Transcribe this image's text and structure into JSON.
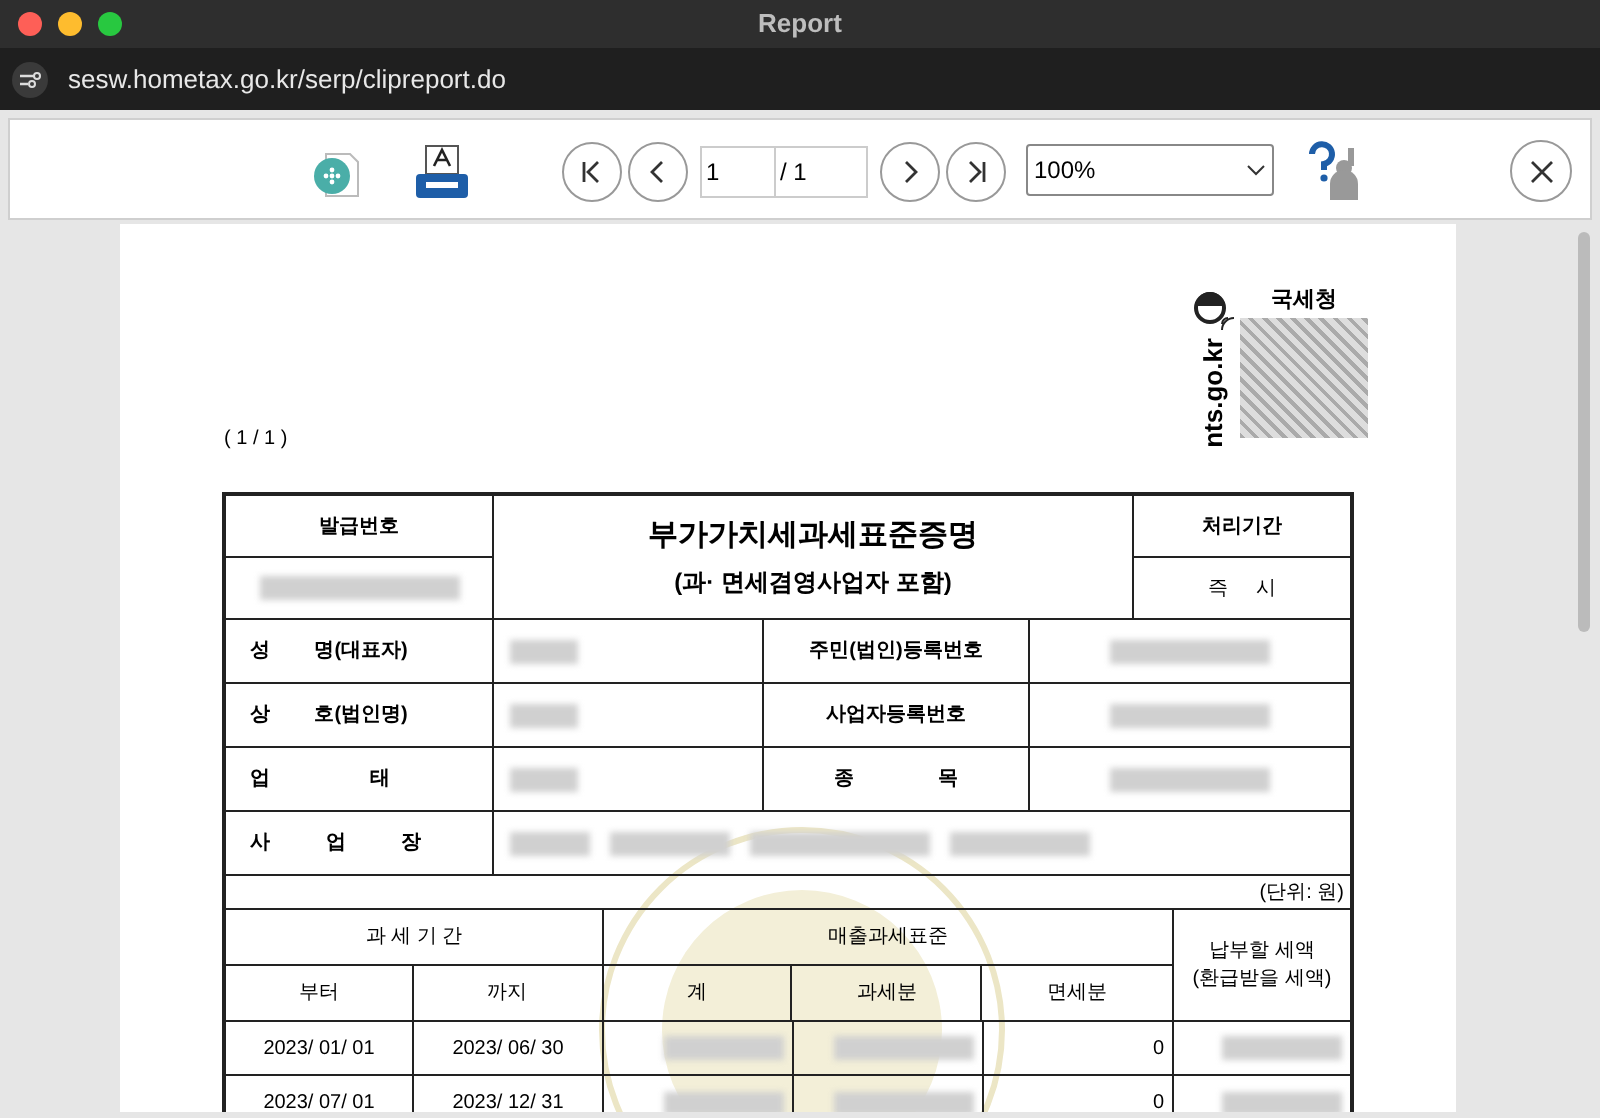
{
  "window": {
    "title": "Report"
  },
  "address_bar": {
    "url": "sesw.hometax.go.kr/serp/clipreport.do"
  },
  "toolbar": {
    "page_input": "1",
    "page_total": "/ 1",
    "zoom": "100%"
  },
  "document": {
    "page_indicator": "( 1 / 1 )",
    "agency": "국세청",
    "site": "nts.go.kr",
    "issue_label": "발급번호",
    "title": "부가가치세과세표준증명",
    "subtitle": "(과· 면세겸영사업자 포함)",
    "processing_label": "처리기간",
    "processing_value": "즉     시",
    "info_rows": [
      {
        "label": "성        명(대표자)",
        "label_2": "주민(법인)등록번호"
      },
      {
        "label": "상        호(법인명)",
        "label_2": "사업자등록번호"
      },
      {
        "label": "업                  태",
        "label_2": "종               목"
      },
      {
        "label": "사          업          장"
      }
    ],
    "unit": "(단위: 원)",
    "period_header": "과 세 기 간",
    "base_header": "매출과세표준",
    "tax_header": "납부할 세액\n(환급받을 세액)",
    "sub_headers": [
      "부터",
      "까지",
      "계",
      "과세분",
      "면세분"
    ],
    "rows": [
      {
        "from": "2023/ 01/ 01",
        "to": "2023/ 06/ 30",
        "exempt": "0"
      },
      {
        "from": "2023/ 07/ 01",
        "to": "2023/ 12/ 31",
        "exempt": "0"
      }
    ]
  }
}
